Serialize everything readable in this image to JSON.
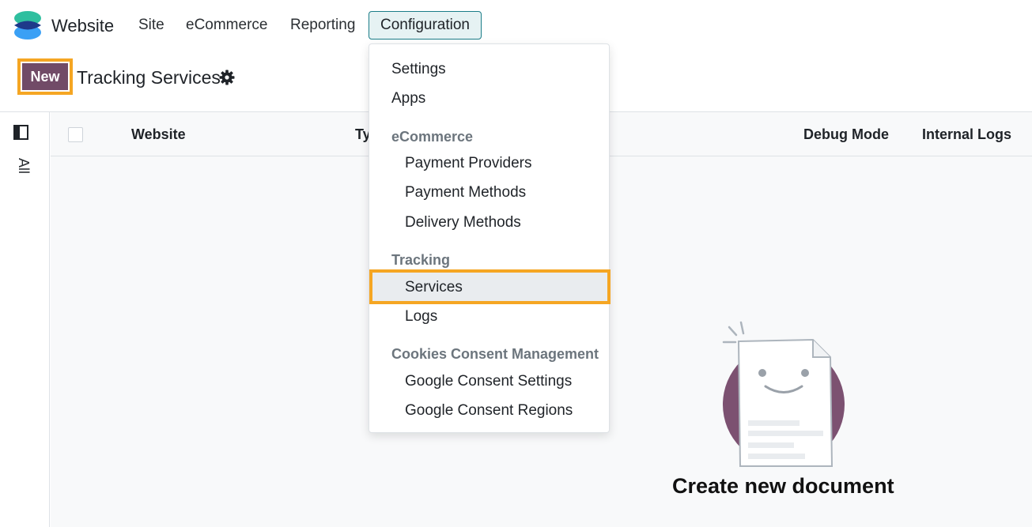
{
  "navbar": {
    "app_title": "Website",
    "menus": [
      "Site",
      "eCommerce",
      "Reporting",
      "Configuration"
    ]
  },
  "control_panel": {
    "new_button": "New",
    "title": "Tracking Services"
  },
  "sidebar": {
    "filter_all": "All"
  },
  "list": {
    "columns": [
      "Website",
      "Ty",
      "Debug Mode",
      "Internal Logs"
    ]
  },
  "empty_state": {
    "title": "Create new document"
  },
  "dropdown": {
    "items": {
      "settings": "Settings",
      "apps": "Apps",
      "section_ecommerce": "eCommerce",
      "payment_providers": "Payment Providers",
      "payment_methods": "Payment Methods",
      "delivery_methods": "Delivery Methods",
      "section_tracking": "Tracking",
      "services": "Services",
      "logs": "Logs",
      "section_cookies": "Cookies Consent Management",
      "google_consent_settings": "Google Consent Settings",
      "google_consent_regions": "Google Consent Regions"
    }
  },
  "colors": {
    "brand": "#714b67",
    "accent": "#1b7d88",
    "highlight": "#f5a623"
  }
}
